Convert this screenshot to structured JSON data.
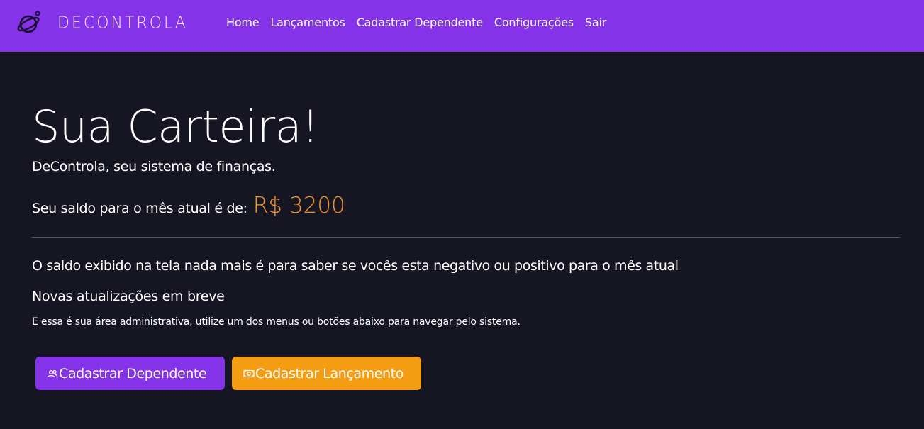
{
  "brand": {
    "name": "DECONTROLA",
    "logo_icon": "planet-icon"
  },
  "nav": {
    "items": [
      {
        "label": "Home"
      },
      {
        "label": "Lançamentos"
      },
      {
        "label": "Cadastrar Dependente"
      },
      {
        "label": "Configurações"
      },
      {
        "label": "Sair"
      }
    ]
  },
  "main": {
    "title": "Sua Carteira!",
    "subtitle": "DeControla, seu sistema de finanças.",
    "balance_label": "Seu saldo para o mês atual é de:",
    "balance_value": "R$ 3200",
    "info_1": "O saldo exibido na tela nada mais é para saber se vocês esta negativo ou positivo para o mês atual",
    "info_2": "Novas atualizações em breve",
    "info_3": "E essa é sua área administrativa, utilize um dos menus ou botões abaixo para navegar pelo sistema."
  },
  "actions": {
    "dependent_button": {
      "label": "Cadastrar Dependente",
      "icon": "people-icon"
    },
    "entry_button": {
      "label": "Cadastrar Lançamento",
      "icon": "cash-icon"
    }
  },
  "colors": {
    "nav_bg": "#8433e9",
    "page_bg": "#151622",
    "balance_accent": "#f0922b",
    "primary_button": "#8433e9",
    "secondary_button": "#f49c12"
  }
}
